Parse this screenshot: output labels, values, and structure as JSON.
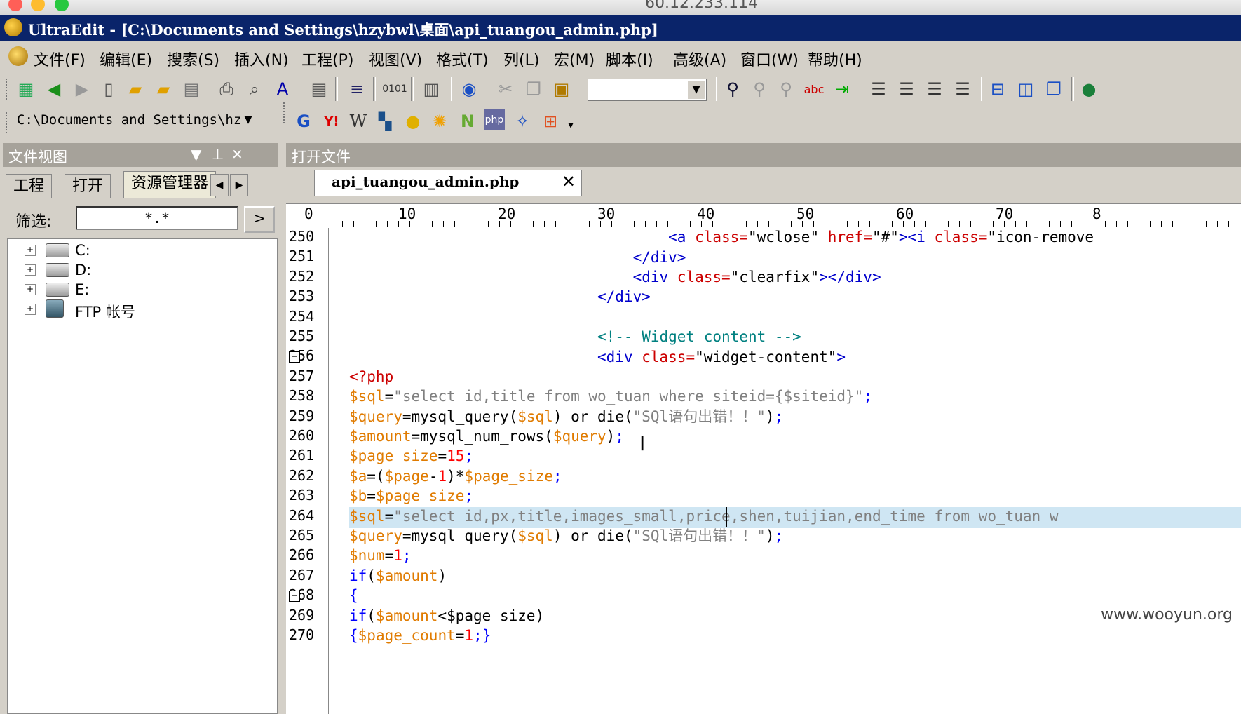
{
  "mac": {
    "host": "60.12.233.114"
  },
  "window": {
    "title": "UltraEdit - [C:\\Documents and Settings\\hzybwl\\桌面\\api_tuangou_admin.php]"
  },
  "menu": [
    "文件(F)",
    "编辑(E)",
    "搜索(S)",
    "插入(N)",
    "工程(P)",
    "视图(V)",
    "格式(T)",
    "列(L)",
    "宏(M)",
    "脚本(I)",
    "高级(A)",
    "窗口(W)",
    "帮助(H)"
  ],
  "toolbar2": {
    "path": "C:\\Documents and Settings\\hzyb"
  },
  "left_panel": {
    "title": "文件视图",
    "tabs": [
      "工程",
      "打开",
      "资源管理器"
    ],
    "filter_label": "筛选:",
    "filter_value": "*.*",
    "tree": [
      "C:",
      "D:",
      "E:",
      "FTP 帐号"
    ]
  },
  "editor": {
    "panel_title": "打开文件",
    "file_tab": "api_tuangou_admin.php",
    "ruler": [
      "0",
      "10",
      "20",
      "30",
      "40",
      "50",
      "60",
      "70",
      "8"
    ],
    "line_numbers": [
      "250",
      "251",
      "252",
      "253",
      "254",
      "255",
      "256",
      "257",
      "258",
      "259",
      "260",
      "261",
      "262",
      "263",
      "264",
      "265",
      "266",
      "267",
      "268",
      "269",
      "270"
    ]
  },
  "watermark": "www.wooyun.org"
}
